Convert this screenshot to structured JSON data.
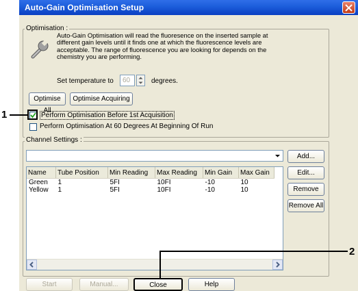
{
  "window": {
    "title": "Auto-Gain Optimisation Setup"
  },
  "optimisation": {
    "group_label": "Optimisation :",
    "description_line1": "Auto-Gain Optimisation will read the fluoresence on the inserted sample at",
    "description_line2": "different gain levels until it finds one at which the fluorescence levels are",
    "description_line3": "acceptable. The range of fluorescence you are looking for depends on the",
    "description_line4": "chemistry you are performing.",
    "set_temperature_label": "Set temperature to",
    "temperature_value": "60",
    "degrees_label": "degrees.",
    "optimise_all_label": "Optimise All",
    "optimise_acquiring_label": "Optimise Acquiring",
    "checkbox_before_acquisition": {
      "label": "Perform Optimisation Before 1st Acquisition",
      "checked": true
    },
    "checkbox_60_degrees": {
      "label": "Perform Optimisation At 60 Degrees At Beginning Of Run",
      "checked": false
    }
  },
  "channel_settings": {
    "group_label": "Channel Settings :",
    "dropdown_value": "",
    "columns": [
      "Name",
      "Tube Position",
      "Min Reading",
      "Max Reading",
      "Min Gain",
      "Max Gain"
    ],
    "rows": [
      [
        "Green",
        "1",
        "5FI",
        "10FI",
        "-10",
        "10"
      ],
      [
        "Yellow",
        "1",
        "5FI",
        "10FI",
        "-10",
        "10"
      ]
    ],
    "add_label": "Add...",
    "edit_label": "Edit...",
    "remove_label": "Remove",
    "remove_all_label": "Remove All"
  },
  "footer": {
    "start_label": "Start",
    "manual_label": "Manual...",
    "close_label": "Close",
    "help_label": "Help"
  },
  "annotations": {
    "callout_1": "1",
    "callout_2": "2"
  },
  "colors": {
    "title_bar": "#1d5fdc",
    "dialog_bg": "#ece9d8",
    "annotation": "#000000"
  }
}
